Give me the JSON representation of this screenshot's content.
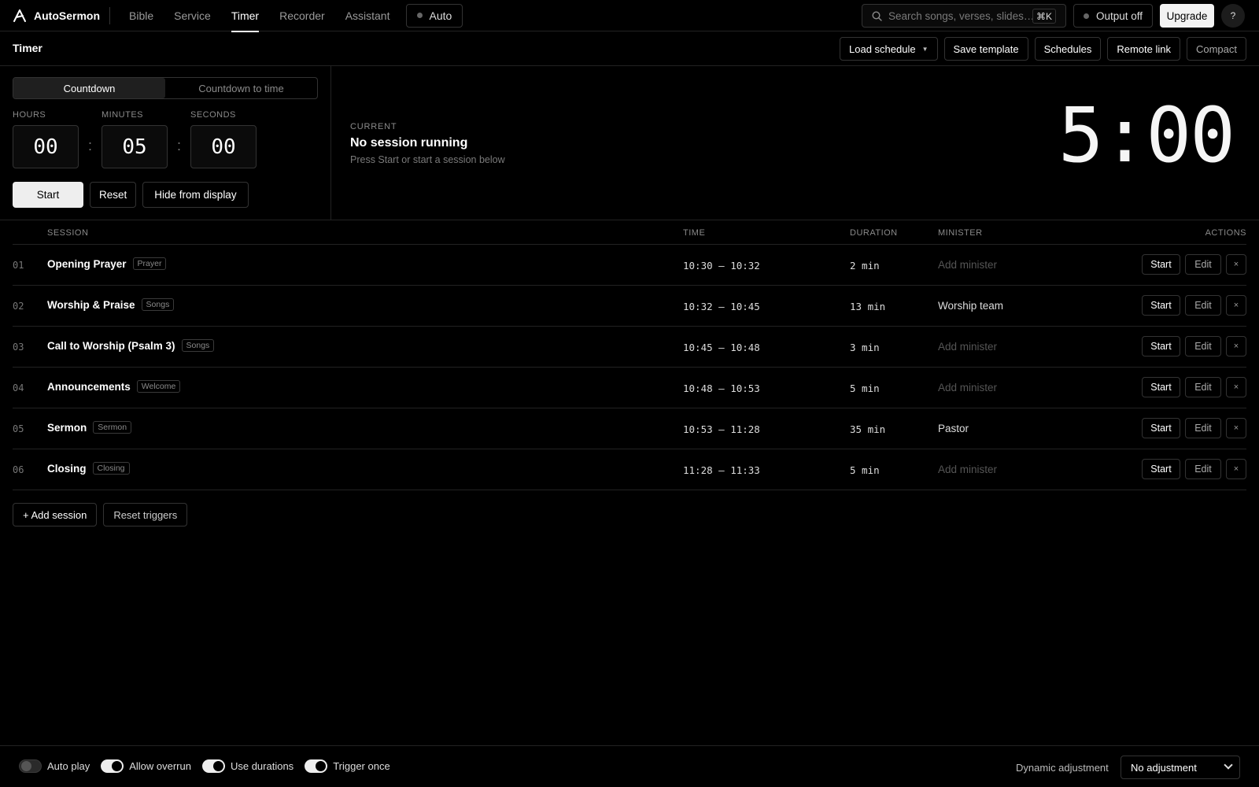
{
  "app": {
    "name": "AutoSermon"
  },
  "nav": {
    "tabs": [
      "Bible",
      "Service",
      "Timer",
      "Recorder",
      "Assistant"
    ],
    "active_tab": "Timer",
    "auto_label": "Auto",
    "search_placeholder": "Search songs, verses, slides…",
    "search_shortcut": "⌘K",
    "output_label": "Output off",
    "upgrade_label": "Upgrade",
    "help_label": "?"
  },
  "subheader": {
    "title": "Timer",
    "load_schedule": "Load schedule",
    "save_template": "Save template",
    "schedules": "Schedules",
    "remote_link": "Remote link",
    "compact": "Compact"
  },
  "timer": {
    "modes": [
      "Countdown",
      "Countdown to time"
    ],
    "active_mode": "Countdown",
    "labels": {
      "hours": "HOURS",
      "minutes": "MINUTES",
      "seconds": "SECONDS"
    },
    "hours": "00",
    "minutes": "05",
    "seconds": "00",
    "sep": ":",
    "start": "Start",
    "reset": "Reset",
    "hide": "Hide from display"
  },
  "current": {
    "label": "CURRENT",
    "title": "No session running",
    "hint": "Press Start or start a session below",
    "clock": "5:00"
  },
  "table": {
    "headers": {
      "session": "SESSION",
      "time": "TIME",
      "duration": "DURATION",
      "minister": "MINISTER",
      "actions": "ACTIONS"
    },
    "rows": [
      {
        "num": "01",
        "name": "Opening Prayer",
        "tag": "Prayer",
        "time": "10:30 – 10:32",
        "duration": "2 min",
        "minister": "Add minister",
        "minister_set": false
      },
      {
        "num": "02",
        "name": "Worship & Praise",
        "tag": "Songs",
        "time": "10:32 – 10:45",
        "duration": "13 min",
        "minister": "Worship team",
        "minister_set": true
      },
      {
        "num": "03",
        "name": "Call to Worship (Psalm 3)",
        "tag": "Songs",
        "time": "10:45 – 10:48",
        "duration": "3 min",
        "minister": "Add minister",
        "minister_set": false
      },
      {
        "num": "04",
        "name": "Announcements",
        "tag": "Welcome",
        "time": "10:48 – 10:53",
        "duration": "5 min",
        "minister": "Add minister",
        "minister_set": false
      },
      {
        "num": "05",
        "name": "Sermon",
        "tag": "Sermon",
        "time": "10:53 – 11:28",
        "duration": "35 min",
        "minister": "Pastor",
        "minister_set": true
      },
      {
        "num": "06",
        "name": "Closing",
        "tag": "Closing",
        "time": "11:28 – 11:33",
        "duration": "5 min",
        "minister": "Add minister",
        "minister_set": false
      }
    ],
    "row_actions": {
      "start": "Start",
      "edit": "Edit",
      "delete": "×"
    },
    "add_session": "+ Add session",
    "reset_triggers": "Reset triggers"
  },
  "footer": {
    "toggles": [
      {
        "label": "Auto play",
        "on": false
      },
      {
        "label": "Allow overrun",
        "on": true
      },
      {
        "label": "Use durations",
        "on": true
      },
      {
        "label": "Trigger once",
        "on": true
      }
    ],
    "dynamic_label": "Dynamic adjustment",
    "dynamic_value": "No adjustment"
  }
}
